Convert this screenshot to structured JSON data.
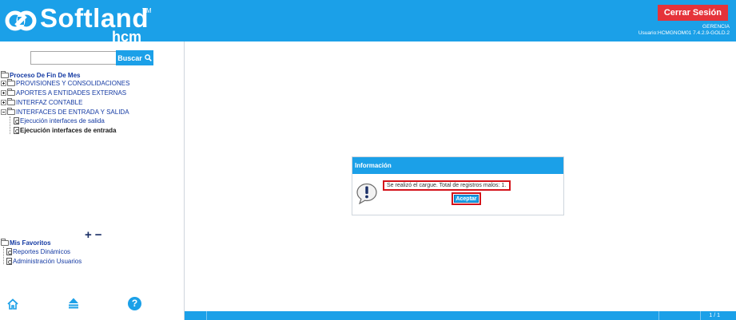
{
  "header": {
    "logo_word": "Softland",
    "logo_tm": "TM",
    "logo_sub": "hcm",
    "logout_label": "Cerrar Sesión",
    "company": "GERENCIA",
    "user_line": "Usuario:HCMGNOM01 7.4.2.9-GOLD.2"
  },
  "sidebar": {
    "search_value": "",
    "search_label": "Buscar",
    "tree_root": "Proceso De Fin De Mes",
    "folders": [
      "PROVISIONES Y CONSOLIDACIONES",
      "APORTES A ENTIDADES EXTERNAS",
      "INTERFAZ CONTABLE",
      "INTERFACES DE ENTRADA Y SALIDA"
    ],
    "leaves": [
      "Ejecución interfaces de salida",
      "Ejecución interfaces de entrada"
    ],
    "zoom_in": "+",
    "zoom_out": "−",
    "favorites_root": "Mis Favoritos",
    "favorites": [
      "Reportes Dinámicos",
      "Administración Usuarios"
    ],
    "help_glyph": "?"
  },
  "dialog": {
    "title": "Información",
    "message": "Se realizó el cargue. Total de registros malos: 1.",
    "accept_label": "Aceptar"
  },
  "footer": {
    "pager": "1 / 1"
  },
  "colors": {
    "brand_blue": "#1ba0e8",
    "logout_red": "#e5333a",
    "highlight_red": "#d4131a",
    "tree_blue": "#143aa3"
  }
}
